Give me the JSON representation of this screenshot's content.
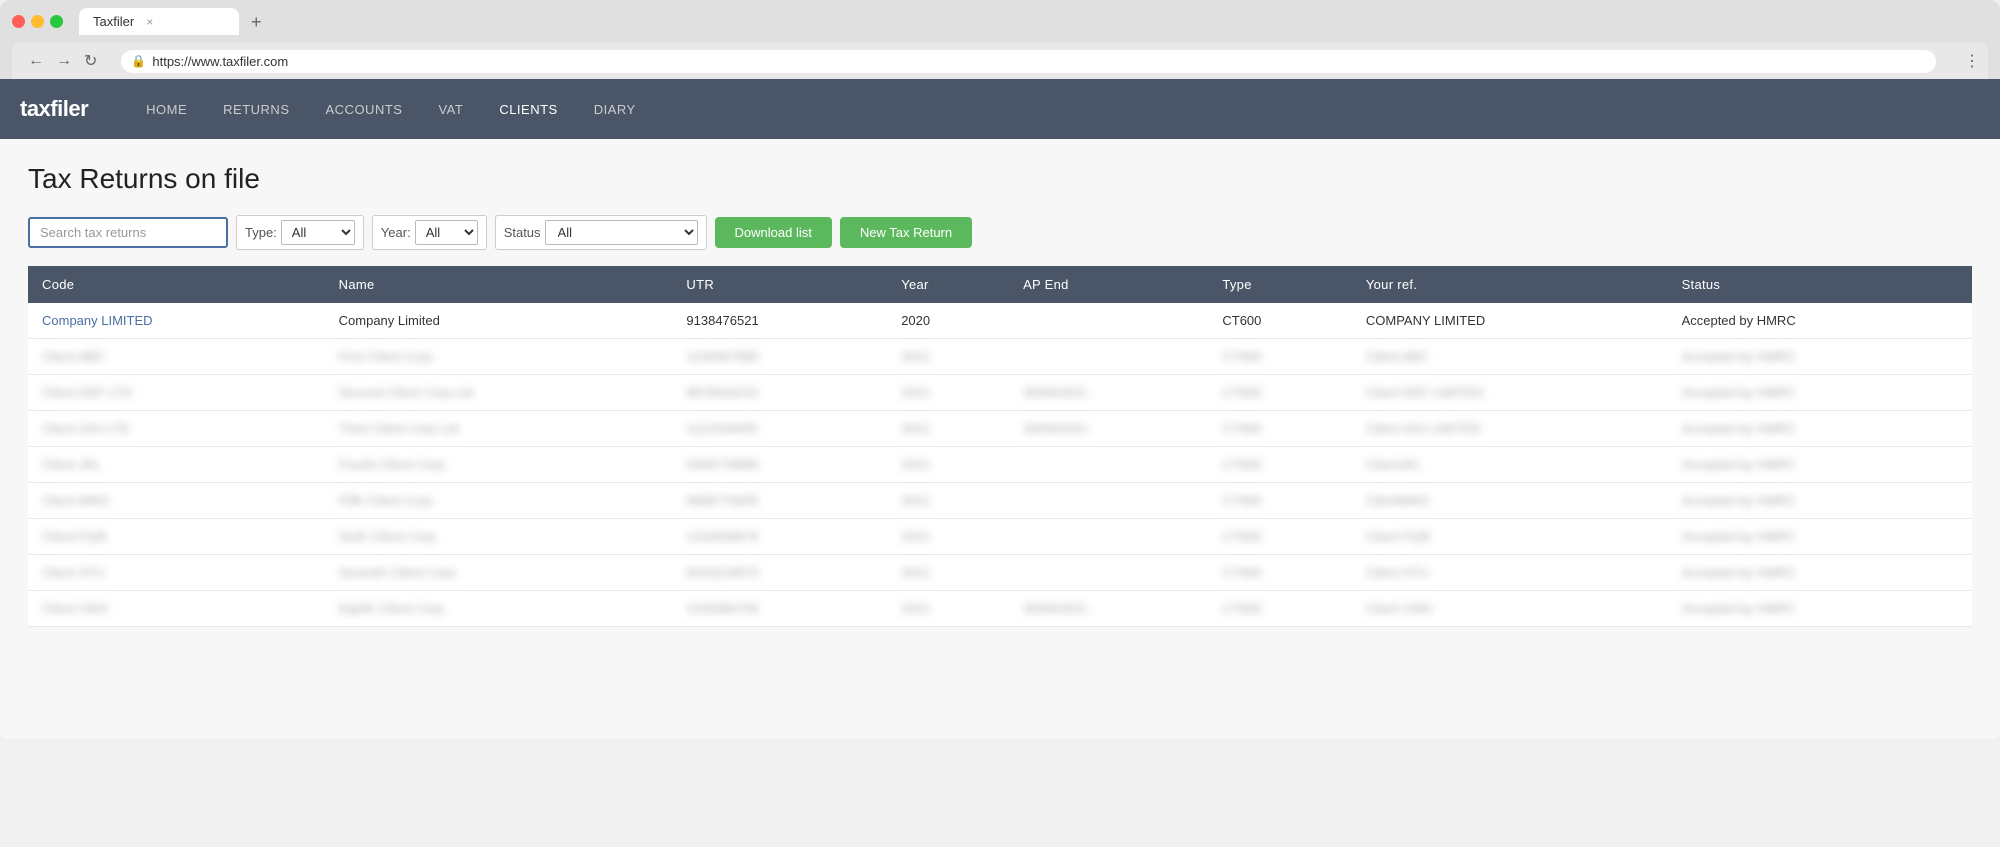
{
  "browser": {
    "url": "https://www.taxfiler.com",
    "tab_title": "Taxfiler",
    "tab_close": "×",
    "tab_add": "+",
    "nav_back": "←",
    "nav_forward": "→",
    "nav_refresh": "↻",
    "nav_lock": "🔒",
    "nav_menu": "⋮"
  },
  "app": {
    "logo": "taxfiler",
    "nav_items": [
      {
        "label": "HOME",
        "active": false
      },
      {
        "label": "RETURNS",
        "active": false
      },
      {
        "label": "ACCOUNTS",
        "active": false
      },
      {
        "label": "VAT",
        "active": false
      },
      {
        "label": "CLIENTS",
        "active": true
      },
      {
        "label": "DIARY",
        "active": false
      }
    ]
  },
  "page": {
    "title": "Tax Returns on file"
  },
  "toolbar": {
    "search_placeholder": "Search tax returns",
    "type_label": "Type:",
    "type_value": "All",
    "year_label": "Year:",
    "year_value": "All",
    "status_label": "Status",
    "status_value": "All",
    "download_btn": "Download list",
    "new_btn": "New Tax Return"
  },
  "table": {
    "columns": [
      "Code",
      "Name",
      "UTR",
      "Year",
      "AP End",
      "Type",
      "Your ref.",
      "Status"
    ],
    "rows": [
      {
        "code": "Company LIMITED",
        "name": "Company Limited",
        "utr": "9138476521",
        "year": "2020",
        "ap_end": "",
        "type": "CT600",
        "your_ref": "COMPANY LIMITED",
        "status": "Accepted by HMRC",
        "is_link": true,
        "blurred": false
      },
      {
        "code": "Client ABC",
        "name": "First Client Corp",
        "utr": "1234567890",
        "year": "2021",
        "ap_end": "",
        "type": "CT600",
        "your_ref": "Client ABC",
        "status": "Accepted by HMRC",
        "is_link": true,
        "blurred": true
      },
      {
        "code": "Client DEF LTD",
        "name": "Second Client Corp Ltd",
        "utr": "9876543210",
        "year": "2021",
        "ap_end": "30/09/2021",
        "type": "CT600",
        "your_ref": "Client DEF LIMITED",
        "status": "Accepted by HMRC",
        "is_link": true,
        "blurred": true
      },
      {
        "code": "Client GHI LTD",
        "name": "Third Client Corp Ltd",
        "utr": "1122334455",
        "year": "2021",
        "ap_end": "30/09/2021",
        "type": "CT600",
        "your_ref": "Client GHI LIMITED",
        "status": "Accepted by HMRC",
        "is_link": true,
        "blurred": true
      },
      {
        "code": "Client JKL",
        "name": "Fourth Client Corp",
        "utr": "5566778899",
        "year": "2021",
        "ap_end": "",
        "type": "CT600",
        "your_ref": "ClientJKL",
        "status": "Accepted by HMRC",
        "is_link": true,
        "blurred": true
      },
      {
        "code": "Client MNO",
        "name": "Fifth Client Corp",
        "utr": "9988776655",
        "year": "2021",
        "ap_end": "",
        "type": "CT600",
        "your_ref": "ClientMNO",
        "status": "Accepted by HMRC",
        "is_link": true,
        "blurred": true
      },
      {
        "code": "Client PQR",
        "name": "Sixth Client Corp",
        "utr": "1234509876",
        "year": "2021",
        "ap_end": "",
        "type": "CT600",
        "your_ref": "Client PQR",
        "status": "Accepted by HMRC",
        "is_link": true,
        "blurred": true
      },
      {
        "code": "Client STU",
        "name": "Seventh Client Corp",
        "utr": "6543219870",
        "year": "2021",
        "ap_end": "",
        "type": "CT600",
        "your_ref": "Client STU",
        "status": "Accepted by HMRC",
        "is_link": true,
        "blurred": true
      },
      {
        "code": "Client VWX",
        "name": "Eighth Client Corp",
        "utr": "1029384756",
        "year": "2021",
        "ap_end": "30/09/2021",
        "type": "CT600",
        "your_ref": "Client VWX",
        "status": "Accepted by HMRC",
        "is_link": true,
        "blurred": true
      }
    ]
  }
}
